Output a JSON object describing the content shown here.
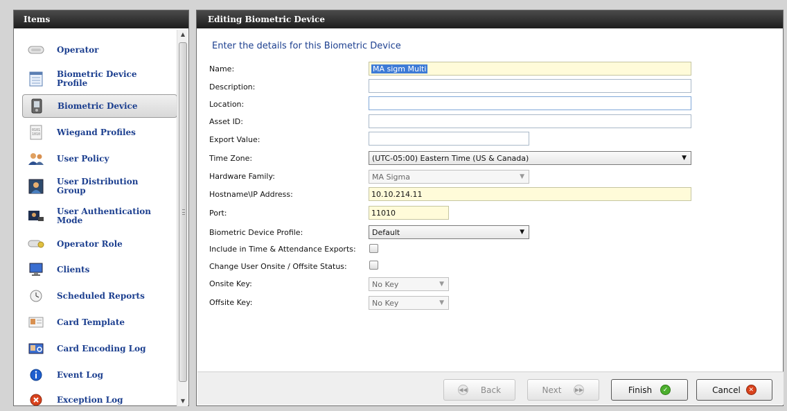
{
  "left_panel": {
    "title": "Items",
    "items": [
      {
        "label": "Operator",
        "icon": "operator-icon"
      },
      {
        "label": "Biometric Device Profile",
        "icon": "device-profile-icon"
      },
      {
        "label": "Biometric Device",
        "icon": "biometric-device-icon",
        "selected": true
      },
      {
        "label": "Wiegand Profiles",
        "icon": "wiegand-icon"
      },
      {
        "label": "User Policy",
        "icon": "user-policy-icon"
      },
      {
        "label": "User Distribution Group",
        "icon": "distribution-group-icon"
      },
      {
        "label": "User Authentication Mode",
        "icon": "authentication-mode-icon"
      },
      {
        "label": "Operator Role",
        "icon": "operator-role-icon"
      },
      {
        "label": "Clients",
        "icon": "clients-icon"
      },
      {
        "label": "Scheduled Reports",
        "icon": "scheduled-reports-icon"
      },
      {
        "label": "Card Template",
        "icon": "card-template-icon"
      },
      {
        "label": "Card Encoding Log",
        "icon": "card-encoding-log-icon"
      },
      {
        "label": "Event Log",
        "icon": "info-icon"
      },
      {
        "label": "Exception Log",
        "icon": "error-icon"
      }
    ]
  },
  "right_panel": {
    "title": "Editing Biometric Device",
    "heading": "Enter the details for this Biometric Device",
    "fields": {
      "name": {
        "label": "Name:",
        "value": "MA sigm Multi"
      },
      "description": {
        "label": "Description:",
        "value": ""
      },
      "location": {
        "label": "Location:",
        "value": ""
      },
      "asset_id": {
        "label": "Asset ID:",
        "value": ""
      },
      "export_value": {
        "label": "Export Value:",
        "value": ""
      },
      "time_zone": {
        "label": "Time Zone:",
        "value": "(UTC-05:00) Eastern Time (US & Canada)"
      },
      "hardware_family": {
        "label": "Hardware Family:",
        "value": "MA Sigma"
      },
      "hostname": {
        "label": "Hostname\\IP Address:",
        "value": "10.10.214.11"
      },
      "port": {
        "label": "Port:",
        "value": "11010"
      },
      "device_profile": {
        "label": "Biometric Device Profile:",
        "value": "Default"
      },
      "time_attendance": {
        "label": "Include in Time & Attendance Exports:",
        "checked": false
      },
      "onsite_status": {
        "label": "Change User Onsite / Offsite Status:",
        "checked": false
      },
      "onsite_key": {
        "label": "Onsite Key:",
        "value": "No Key"
      },
      "offsite_key": {
        "label": "Offsite Key:",
        "value": "No Key"
      }
    }
  },
  "footer": {
    "back": "Back",
    "next": "Next",
    "finish": "Finish",
    "cancel": "Cancel"
  },
  "colors": {
    "link_blue": "#1c3f8f",
    "header_dark": "#1d1d1d",
    "field_yellow": "#fffbd9",
    "finish_green": "#4caf2e",
    "cancel_red": "#d9421c"
  }
}
